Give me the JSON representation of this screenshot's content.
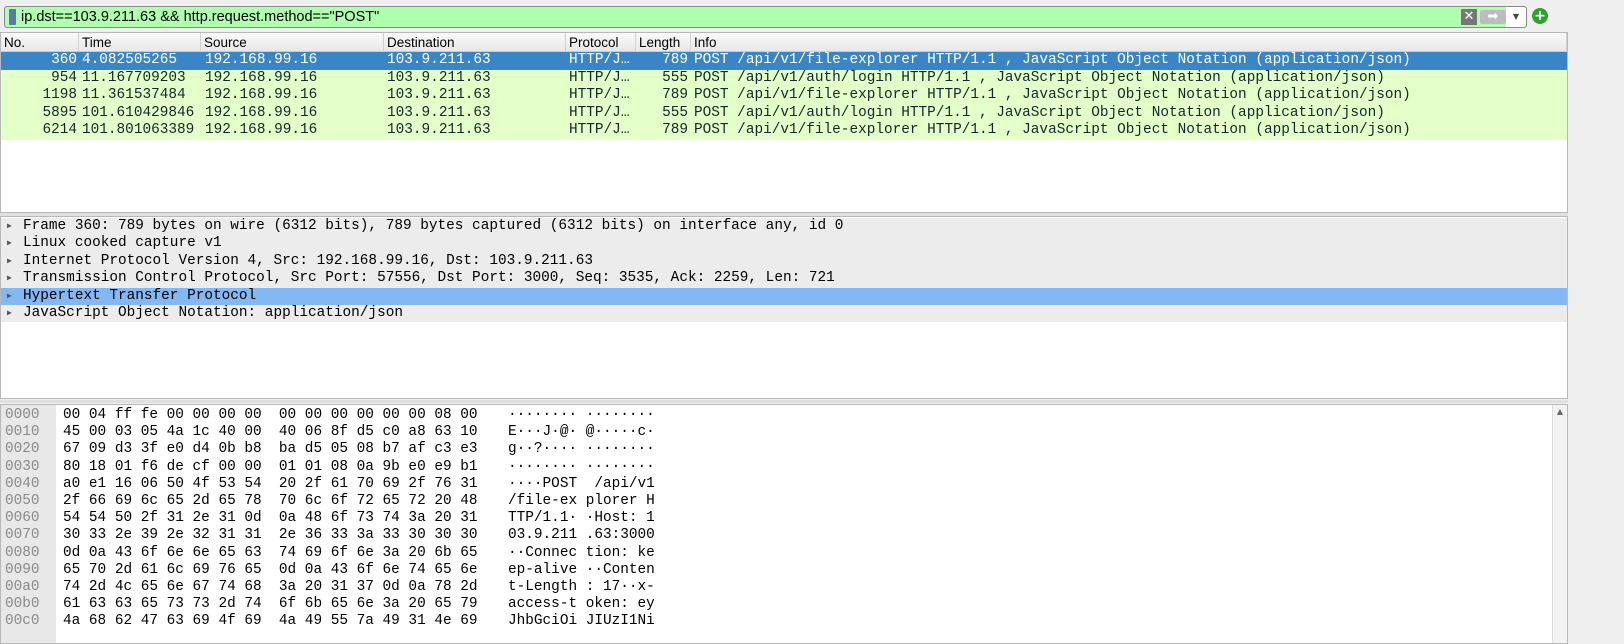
{
  "filter": {
    "value": "ip.dst==103.9.211.63 && http.request.method==\"POST\"",
    "clear_icon": "✕",
    "apply_icon": "➡",
    "dropdown_icon": "▼",
    "add_icon": "+"
  },
  "packet_list": {
    "columns": [
      "No.",
      "Time",
      "Source",
      "Destination",
      "Protocol",
      "Length",
      "Info"
    ],
    "rows": [
      {
        "no": "360",
        "time": "4.082505265",
        "src": "192.168.99.16",
        "dst": "103.9.211.63",
        "proto": "HTTP/J…",
        "len": "789",
        "info": "POST /api/v1/file-explorer HTTP/1.1 , JavaScript Object Notation (application/json)",
        "selected": true
      },
      {
        "no": "954",
        "time": "11.167709203",
        "src": "192.168.99.16",
        "dst": "103.9.211.63",
        "proto": "HTTP/J…",
        "len": "555",
        "info": "POST /api/v1/auth/login HTTP/1.1 , JavaScript Object Notation (application/json)"
      },
      {
        "no": "1198",
        "time": "11.361537484",
        "src": "192.168.99.16",
        "dst": "103.9.211.63",
        "proto": "HTTP/J…",
        "len": "789",
        "info": "POST /api/v1/file-explorer HTTP/1.1 , JavaScript Object Notation (application/json)"
      },
      {
        "no": "5895",
        "time": "101.610429846",
        "src": "192.168.99.16",
        "dst": "103.9.211.63",
        "proto": "HTTP/J…",
        "len": "555",
        "info": "POST /api/v1/auth/login HTTP/1.1 , JavaScript Object Notation (application/json)"
      },
      {
        "no": "6214",
        "time": "101.801063389",
        "src": "192.168.99.16",
        "dst": "103.9.211.63",
        "proto": "HTTP/J…",
        "len": "789",
        "info": "POST /api/v1/file-explorer HTTP/1.1 , JavaScript Object Notation (application/json)"
      }
    ]
  },
  "details": [
    {
      "text": "Frame 360: 789 bytes on wire (6312 bits), 789 bytes captured (6312 bits) on interface any, id 0"
    },
    {
      "text": "Linux cooked capture v1"
    },
    {
      "text": "Internet Protocol Version 4, Src: 192.168.99.16, Dst: 103.9.211.63"
    },
    {
      "text": "Transmission Control Protocol, Src Port: 57556, Dst Port: 3000, Seq: 3535, Ack: 2259, Len: 721"
    },
    {
      "text": "Hypertext Transfer Protocol",
      "selected": true
    },
    {
      "text": "JavaScript Object Notation: application/json"
    }
  ],
  "hex": [
    {
      "off": "0000",
      "bytes": "00 04 ff fe 00 00 00 00  00 00 00 00 00 00 08 00",
      "ascii": "········ ········"
    },
    {
      "off": "0010",
      "bytes": "45 00 03 05 4a 1c 40 00  40 06 8f d5 c0 a8 63 10",
      "ascii": "E···J·@· @·····c·"
    },
    {
      "off": "0020",
      "bytes": "67 09 d3 3f e0 d4 0b b8  ba d5 05 08 b7 af c3 e3",
      "ascii": "g··?···· ········"
    },
    {
      "off": "0030",
      "bytes": "80 18 01 f6 de cf 00 00  01 01 08 0a 9b e0 e9 b1",
      "ascii": "········ ········"
    },
    {
      "off": "0040",
      "bytes": "a0 e1 16 06 50 4f 53 54  20 2f 61 70 69 2f 76 31",
      "ascii": "····POST  /api/v1"
    },
    {
      "off": "0050",
      "bytes": "2f 66 69 6c 65 2d 65 78  70 6c 6f 72 65 72 20 48",
      "ascii": "/file-ex plorer H"
    },
    {
      "off": "0060",
      "bytes": "54 54 50 2f 31 2e 31 0d  0a 48 6f 73 74 3a 20 31",
      "ascii": "TTP/1.1· ·Host: 1"
    },
    {
      "off": "0070",
      "bytes": "30 33 2e 39 2e 32 31 31  2e 36 33 3a 33 30 30 30",
      "ascii": "03.9.211 .63:3000"
    },
    {
      "off": "0080",
      "bytes": "0d 0a 43 6f 6e 6e 65 63  74 69 6f 6e 3a 20 6b 65",
      "ascii": "··Connec tion: ke"
    },
    {
      "off": "0090",
      "bytes": "65 70 2d 61 6c 69 76 65  0d 0a 43 6f 6e 74 65 6e",
      "ascii": "ep-alive ··Conten"
    },
    {
      "off": "00a0",
      "bytes": "74 2d 4c 65 6e 67 74 68  3a 20 31 37 0d 0a 78 2d",
      "ascii": "t-Length : 17··x-"
    },
    {
      "off": "00b0",
      "bytes": "61 63 63 65 73 73 2d 74  6f 6b 65 6e 3a 20 65 79",
      "ascii": "access-t oken: ey"
    },
    {
      "off": "00c0",
      "bytes": "4a 68 62 47 63 69 4f 69  4a 49 55 7a 49 31 4e 69",
      "ascii": "JhbGciOi JIUzI1Ni"
    }
  ],
  "scroll_up_icon": "▲"
}
